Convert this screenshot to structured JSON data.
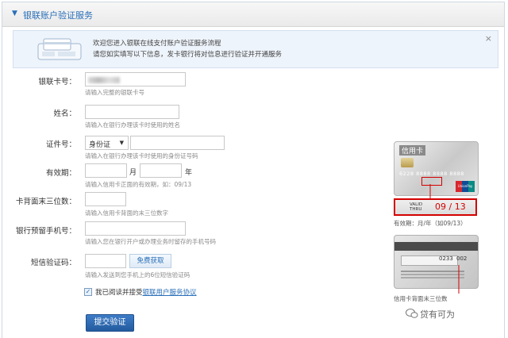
{
  "header": {
    "title": "银联账户验证服务"
  },
  "welcome": {
    "line1": "欢迎您进入银联在线支付账户验证服务流程",
    "line2": "请您如实填写以下信息，发卡银行将对信息进行验证并开通服务",
    "close": "×"
  },
  "form": {
    "card_number": {
      "label": "银联卡号：",
      "value": "",
      "hint": "请输入完整的银联卡号"
    },
    "name": {
      "label": "姓名：",
      "value": "",
      "hint": "请输入在银行办理该卡时使用的姓名"
    },
    "id": {
      "label": "证件号：",
      "type_selected": "身份证",
      "value": "",
      "hint": "请输入在银行办理该卡时使用的身份证号码"
    },
    "expiry": {
      "label": "有效期：",
      "month_suffix": "月",
      "year_suffix": "年",
      "hint": "请输入信用卡正面的有效期，如：09/13"
    },
    "cvn": {
      "label": "卡背面末三位数：",
      "hint": "请输入信用卡背面的末三位数字"
    },
    "phone": {
      "label": "银行预留手机号：",
      "hint": "请输入您在银行开户或办理业务时留存的手机号码"
    },
    "sms": {
      "label": "短信验证码：",
      "button": "免费获取",
      "hint": "请输入发送到您手机上的6位短信验证码"
    },
    "agree": {
      "text": "我已阅读并接受",
      "link": "银联用户服务协议",
      "checked": true
    },
    "submit": "提交验证"
  },
  "sample": {
    "card_brand": "信用卡",
    "card_number": "6228 8888 8888 8888",
    "valid_thru_label_1": "VALID",
    "valid_thru_label_2": "THRU",
    "valid_date": "09 / 13",
    "valid_note": "有效期：月/年（如09/13）",
    "back_num1": "0233",
    "back_num2": "002",
    "back_note": "信用卡背面末三位数"
  },
  "watermark": "贷有可为"
}
